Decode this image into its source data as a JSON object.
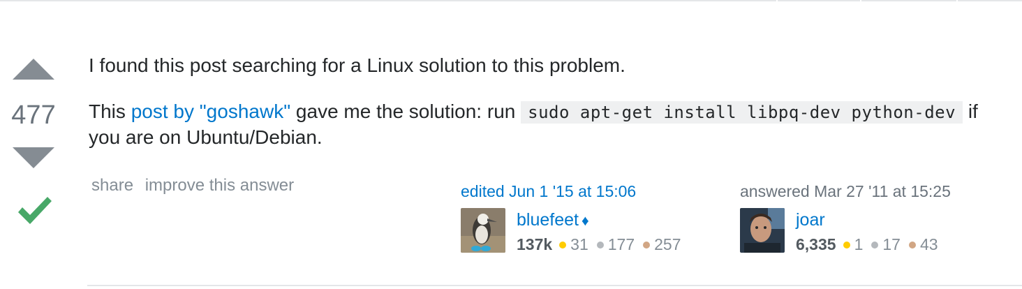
{
  "vote": {
    "count": "477"
  },
  "post": {
    "para1": "I found this post searching for a Linux solution to this problem.",
    "para2_prefix": "This ",
    "para2_link": "post by \"goshawk\"",
    "para2_middle": " gave me the solution: run ",
    "para2_code": "sudo apt-get install libpq-dev python-dev",
    "para2_suffix": " if you are on Ubuntu/Debian."
  },
  "menu": {
    "share": "share",
    "improve": "improve this answer"
  },
  "edited": {
    "action": "edited Jun 1 '15 at 15:06",
    "user": "bluefeet",
    "moderator_mark": "♦",
    "reputation": "137k",
    "gold": "31",
    "silver": "177",
    "bronze": "257"
  },
  "answered": {
    "action": "answered Mar 27 '11 at 15:25",
    "user": "joar",
    "reputation": "6,335",
    "gold": "1",
    "silver": "17",
    "bronze": "43"
  },
  "colors": {
    "link": "#0077cc",
    "accepted": "#48a868",
    "vote_arrow": "#858c93",
    "gold": "#ffcc01",
    "silver": "#b4b8bc",
    "bronze": "#d1a684"
  },
  "icons": {
    "upvote": "upvote-arrow-icon",
    "downvote": "downvote-arrow-icon",
    "accepted": "accepted-checkmark-icon",
    "moderator": "moderator-diamond-icon"
  }
}
